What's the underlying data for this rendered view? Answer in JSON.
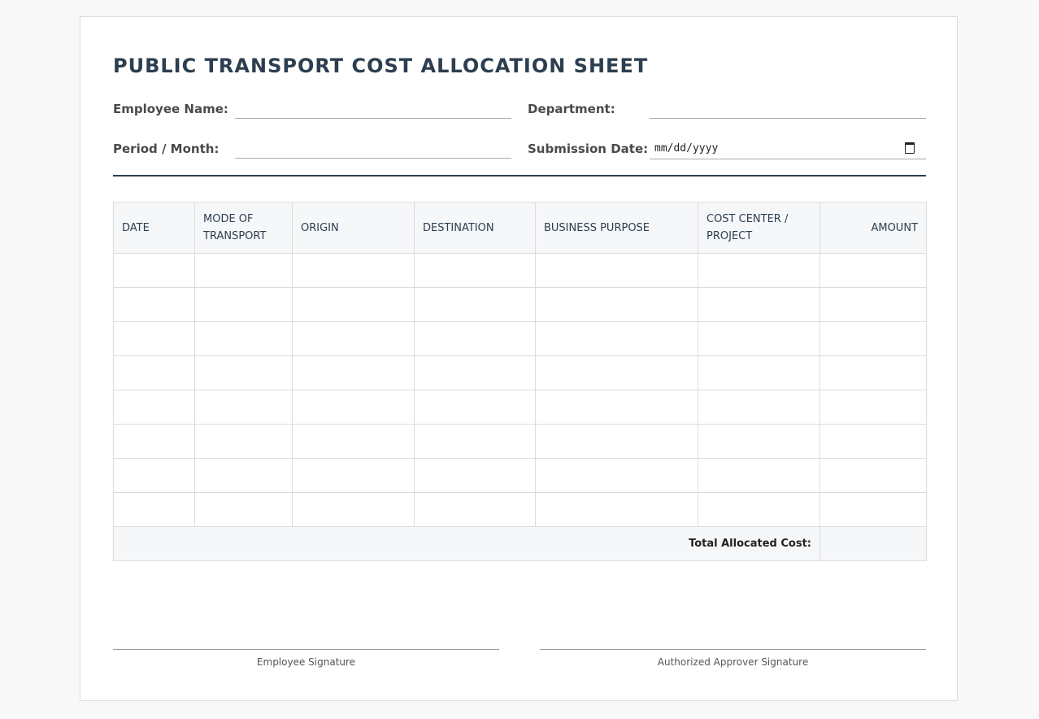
{
  "title": "PUBLIC TRANSPORT COST ALLOCATION SHEET",
  "fields": {
    "employee_name": {
      "label": "Employee Name:",
      "value": ""
    },
    "department": {
      "label": "Department:",
      "value": ""
    },
    "period": {
      "label": "Period / Month:",
      "value": ""
    },
    "submission_date": {
      "label": "Submission Date:",
      "value": "mm/dd/yyyy",
      "icon": "calendar-icon"
    }
  },
  "table": {
    "columns": [
      "DATE",
      "MODE OF TRANSPORT",
      "ORIGIN",
      "DESTINATION",
      "BUSINESS PURPOSE",
      "COST CENTER / PROJECT",
      "AMOUNT"
    ],
    "rows": [
      [
        "",
        "",
        "",
        "",
        "",
        "",
        ""
      ],
      [
        "",
        "",
        "",
        "",
        "",
        "",
        ""
      ],
      [
        "",
        "",
        "",
        "",
        "",
        "",
        ""
      ],
      [
        "",
        "",
        "",
        "",
        "",
        "",
        ""
      ],
      [
        "",
        "",
        "",
        "",
        "",
        "",
        ""
      ],
      [
        "",
        "",
        "",
        "",
        "",
        "",
        ""
      ],
      [
        "",
        "",
        "",
        "",
        "",
        "",
        ""
      ],
      [
        "",
        "",
        "",
        "",
        "",
        "",
        ""
      ]
    ],
    "total_label": "Total Allocated Cost:",
    "total_value": ""
  },
  "signatures": {
    "employee": "Employee Signature",
    "approver": "Authorized Approver Signature"
  },
  "colors": {
    "heading": "#2c3e50",
    "table_header_bg": "#f6f7f9",
    "border": "#dcdcdc"
  }
}
